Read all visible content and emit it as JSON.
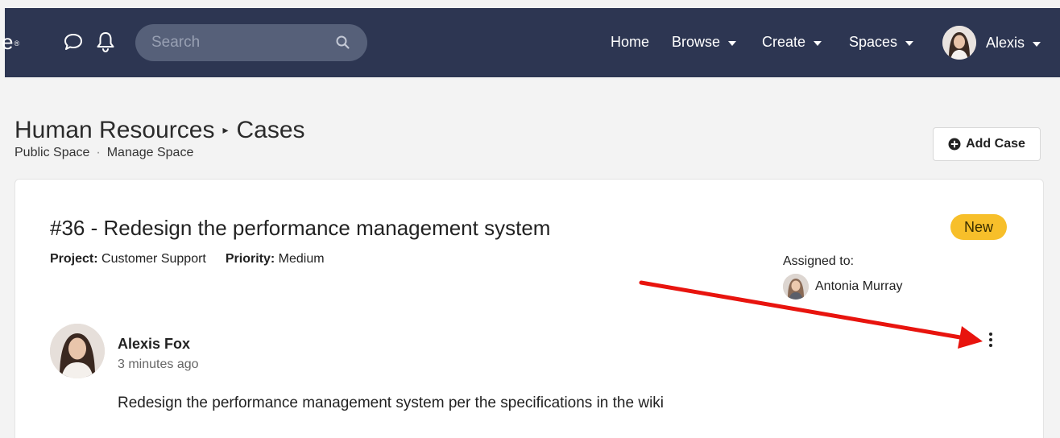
{
  "topbar": {
    "logo_fragment": "e",
    "logo_mark": "®",
    "search": {
      "placeholder": "Search",
      "value": ""
    },
    "nav": {
      "home": "Home",
      "browse": "Browse",
      "create": "Create",
      "spaces": "Spaces",
      "user": "Alexis"
    },
    "bg_color": "#2d3652"
  },
  "page": {
    "breadcrumb": {
      "parent": "Human Resources",
      "current": "Cases"
    },
    "subline": {
      "space_type": "Public Space",
      "separator": "·",
      "manage": "Manage Space"
    },
    "add_case_label": "Add Case"
  },
  "case": {
    "title": "#36 - Redesign the performance management system",
    "status": "New",
    "status_color": "#f7bf2a",
    "project_label": "Project:",
    "project": "Customer Support",
    "priority_label": "Priority:",
    "priority": "Medium",
    "assigned_label": "Assigned to:",
    "assignee": "Antonia Murray"
  },
  "comment": {
    "author": "Alexis Fox",
    "time": "3 minutes ago",
    "body": "Redesign the performance management system per the specifications in the wiki"
  },
  "annotation": {
    "arrow_color": "#e8140e"
  }
}
